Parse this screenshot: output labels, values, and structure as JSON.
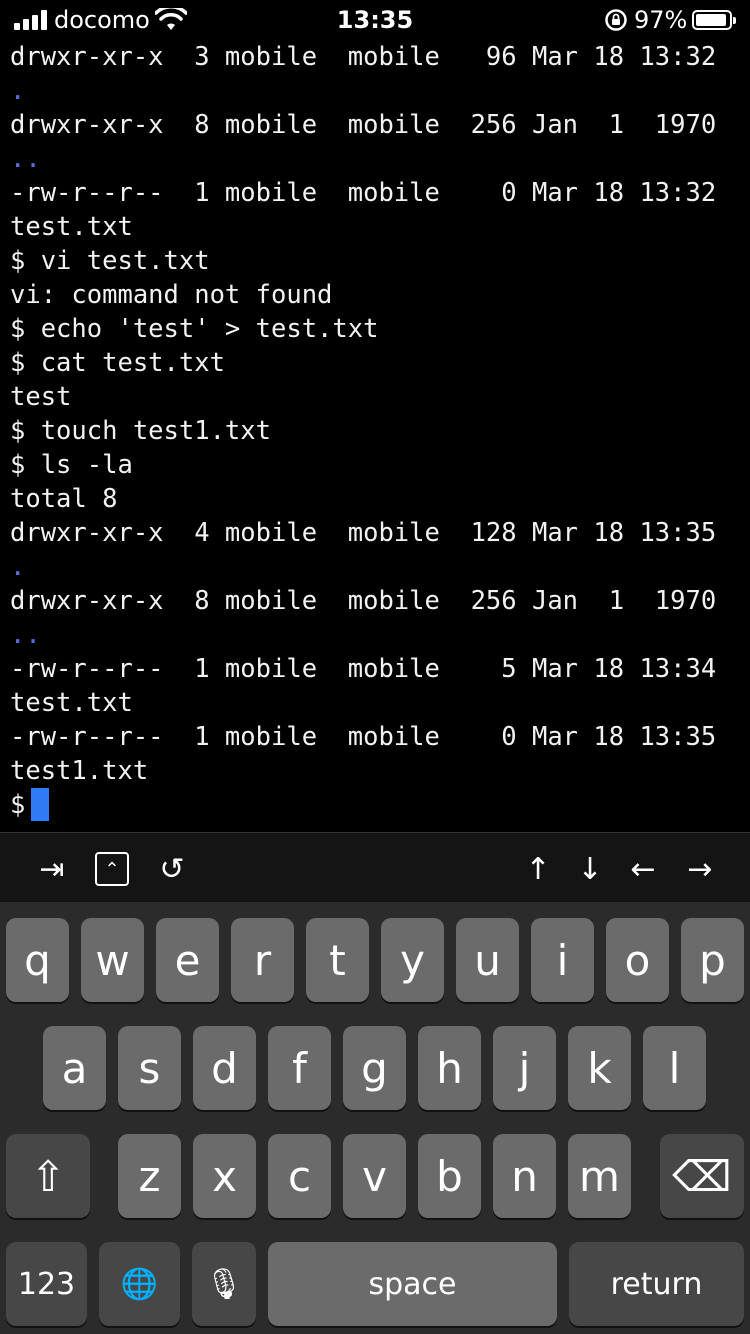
{
  "status_bar": {
    "carrier": "docomo",
    "time": "13:35",
    "battery_percent": "97%",
    "battery_level": 0.97,
    "icons": [
      "signal-icon",
      "wifi-icon",
      "orientation-lock-icon",
      "battery-icon"
    ]
  },
  "terminal": {
    "lines": [
      "drwxr-xr-x  3 mobile  mobile   96 Mar 18 13:32",
      ".",
      "drwxr-xr-x  8 mobile  mobile  256 Jan  1  1970",
      "..",
      "-rw-r--r--  1 mobile  mobile    0 Mar 18 13:32",
      "test.txt",
      "$ vi test.txt",
      "vi: command not found",
      "$ echo 'test' > test.txt",
      "$ cat test.txt",
      "test",
      "$ touch test1.txt",
      "$ ls -la",
      "total 8",
      "drwxr-xr-x  4 mobile  mobile  128 Mar 18 13:35",
      ".",
      "drwxr-xr-x  8 mobile  mobile  256 Jan  1  1970",
      "..",
      "-rw-r--r--  1 mobile  mobile    5 Mar 18 13:34",
      "test.txt",
      "-rw-r--r--  1 mobile  mobile    0 Mar 18 13:35",
      "test1.txt"
    ],
    "prompt": "$",
    "cursor_color": "#2f7bf5",
    "dot_color": "#5b6ee0"
  },
  "accessory_bar": {
    "left": [
      {
        "name": "tab-key-icon",
        "glyph": "⇥"
      },
      {
        "name": "control-key-icon",
        "glyph": "⌃"
      },
      {
        "name": "history-icon",
        "glyph": "↺"
      }
    ],
    "right": [
      {
        "name": "arrow-up-icon",
        "glyph": "↑"
      },
      {
        "name": "arrow-down-icon",
        "glyph": "↓"
      },
      {
        "name": "arrow-left-icon",
        "glyph": "←"
      },
      {
        "name": "arrow-right-icon",
        "glyph": "→"
      }
    ]
  },
  "keyboard": {
    "row1": [
      "q",
      "w",
      "e",
      "r",
      "t",
      "y",
      "u",
      "i",
      "o",
      "p"
    ],
    "row2": [
      "a",
      "s",
      "d",
      "f",
      "g",
      "h",
      "j",
      "k",
      "l"
    ],
    "row3": [
      "z",
      "x",
      "c",
      "v",
      "b",
      "n",
      "m"
    ],
    "shift_glyph": "⇧",
    "delete_glyph": "⌫",
    "numbers_label": "123",
    "globe_glyph": "🌐",
    "mic_glyph": "🎙",
    "space_label": "space",
    "return_label": "return"
  }
}
